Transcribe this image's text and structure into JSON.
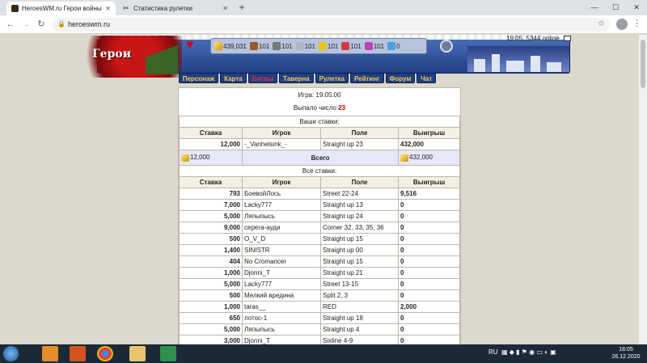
{
  "browser": {
    "tabs": [
      {
        "title": "HeroesWM.ru Герои войны и ден",
        "active": true
      },
      {
        "title": "Статистика рулетки",
        "active": false
      }
    ],
    "url": "heroeswm.ru"
  },
  "header": {
    "logo_text": "Герои",
    "resources": [
      {
        "icon": "gold-icon",
        "value": "439,031"
      },
      {
        "icon": "wood-icon",
        "value": "101"
      },
      {
        "icon": "ore-icon",
        "value": "101"
      },
      {
        "icon": "mercury-icon",
        "value": "101"
      },
      {
        "icon": "sulfur-icon",
        "value": "101"
      },
      {
        "icon": "crystal-icon",
        "value": "101"
      },
      {
        "icon": "gem-icon",
        "value": "101"
      },
      {
        "icon": "mana-icon",
        "value": "0"
      }
    ],
    "status": "19:05, 5344 online"
  },
  "nav": [
    {
      "label": "Персонаж",
      "active": false
    },
    {
      "label": "Карта",
      "active": false
    },
    {
      "label": "Битвы",
      "active": true
    },
    {
      "label": "Таверна",
      "active": false
    },
    {
      "label": "Рулетка",
      "active": false
    },
    {
      "label": "Рейтинг",
      "active": false
    },
    {
      "label": "Форум",
      "active": false
    },
    {
      "label": "Чат",
      "active": false
    }
  ],
  "game": {
    "time_label": "Игра: 19:05:00",
    "result_prefix": "Выпало число",
    "result_number": "23",
    "your_bets_title": "Ваши ставки:",
    "all_bets_title": "Все ставки:",
    "columns": [
      "Ставка",
      "Игрок",
      "Поле",
      "Выигрыш"
    ],
    "your_bets": [
      {
        "bet": "12,000",
        "player": "-_Vanhelsink_-",
        "field": "Straight up 23",
        "win": "432,000"
      }
    ],
    "total": {
      "bet": "12,000",
      "label": "Всего",
      "win": "432,000"
    },
    "all_bets": [
      {
        "bet": "793",
        "player": "БоевойЛось",
        "field": "Street 22-24",
        "win": "9,516"
      },
      {
        "bet": "7,000",
        "player": "Lacky777",
        "field": "Straight up 13",
        "win": "0"
      },
      {
        "bet": "5,000",
        "player": "Ляпыпысь",
        "field": "Straight up 24",
        "win": "0"
      },
      {
        "bet": "9,000",
        "player": "серега-ауди",
        "field": "Corner 32, 33, 35, 36",
        "win": "0"
      },
      {
        "bet": "500",
        "player": "O_V_D",
        "field": "Straight up 15",
        "win": "0"
      },
      {
        "bet": "1,400",
        "player": "SINISTR",
        "field": "Straight up 00",
        "win": "0"
      },
      {
        "bet": "404",
        "player": "No Cromancer",
        "field": "Straight up 15",
        "win": "0"
      },
      {
        "bet": "1,000",
        "player": "Djonni_T",
        "field": "Straight up 21",
        "win": "0"
      },
      {
        "bet": "5,000",
        "player": "Lacky777",
        "field": "Street 13-15",
        "win": "0"
      },
      {
        "bet": "500",
        "player": "Мелкий вредина",
        "field": "Split 2, 3",
        "win": "0"
      },
      {
        "bet": "1,000",
        "player": "taras__",
        "field": "RED",
        "win": "2,000"
      },
      {
        "bet": "650",
        "player": "лотос-1",
        "field": "Straight up 18",
        "win": "0"
      },
      {
        "bet": "5,000",
        "player": "Ляпыпысь",
        "field": "Straight up 4",
        "win": "0"
      },
      {
        "bet": "3,000",
        "player": "Djonni_T",
        "field": "Sixline 4-9",
        "win": "0"
      }
    ]
  },
  "taskbar": {
    "lang": "RU",
    "time": "18:05",
    "date": "26.12.2020"
  }
}
